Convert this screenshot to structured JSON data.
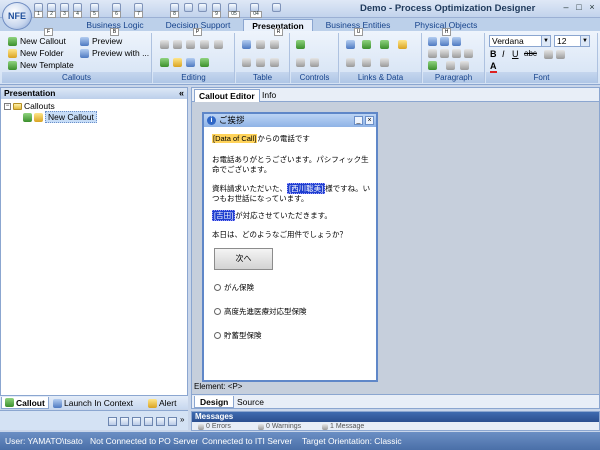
{
  "window": {
    "app_mark": "NFE",
    "title": "Demo - Process Optimization Designer",
    "qat_keys": [
      "1",
      "2",
      "3",
      "4",
      "5",
      "6",
      "7",
      "8",
      "9",
      "05",
      "04"
    ]
  },
  "ribbon_tabs": [
    {
      "label": "Business Logic",
      "key": "B",
      "active": false
    },
    {
      "label": "Decision Support",
      "key": "P",
      "active": false
    },
    {
      "label": "Presentation",
      "key": "R",
      "active": true
    },
    {
      "label": "Business Entities",
      "key": "U",
      "active": false
    },
    {
      "label": "Physical Objects",
      "key": "H",
      "active": false
    }
  ],
  "file_key": "F",
  "ribbon": {
    "callouts": {
      "caption": "Callouts",
      "new_callout": "New Callout",
      "new_folder": "New Folder",
      "new_template": "New Template",
      "preview": "Preview",
      "preview_with": "Preview with ..."
    },
    "editing": {
      "caption": "Editing"
    },
    "table": {
      "caption": "Table"
    },
    "controls": {
      "caption": "Controls"
    },
    "links_data": {
      "caption": "Links & Data"
    },
    "paragraph": {
      "caption": "Paragraph"
    },
    "font": {
      "caption": "Font",
      "family": "Verdana",
      "size": "12"
    }
  },
  "left_panel": {
    "title": "Presentation",
    "collapse": "«",
    "tree": [
      {
        "label": "Callouts",
        "level": 0
      },
      {
        "label": "New Callout",
        "level": 1,
        "selected": true
      }
    ],
    "bottom_tabs": [
      "Callout",
      "Launch In Context",
      "Alert"
    ]
  },
  "editor": {
    "tabs": [
      "Callout Editor",
      "Info"
    ],
    "preview": {
      "title": "ご挨拶",
      "line1_highlight": "[Data of Call]",
      "line1_rest": "からの電話です",
      "para2": "お電話ありがとうございます。パシフィック生命でございます。",
      "para3_a": "資料請求いただいた、",
      "para3_name": "[西川聡美]",
      "para3_b": "様ですね。いつもお世話になっています。",
      "para4_name": "[吉田]",
      "para4_b": "が対応させていただきます。",
      "para5": "本日は、どのようなご用件でしょうか？",
      "next_button": "次へ",
      "options": [
        "がん保険",
        "高度先進医療対応型保険",
        "貯蓄型保険"
      ]
    },
    "element_label": "Element: <P>",
    "bottom_tabs": [
      "Design",
      "Source"
    ]
  },
  "messages": {
    "title": "Messages",
    "errors": "0 Errors",
    "warnings": "0 Warnings",
    "message_count": "1 Message"
  },
  "status": {
    "user": "User: YAMATO\\tsato",
    "po_server": "Not Connected to PO Server",
    "iti_server": "Connected to ITI Server",
    "orientation": "Target Orientation: Classic"
  }
}
